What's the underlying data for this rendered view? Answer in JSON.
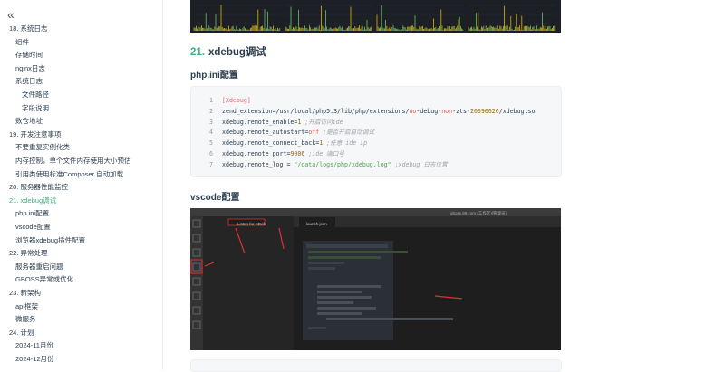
{
  "sidebar": {
    "collapse_icon": "double-chevron-left-icon",
    "items": [
      {
        "label": "18. 系统日志",
        "level": 1
      },
      {
        "label": "组件",
        "level": 2
      },
      {
        "label": "存储时间",
        "level": 2
      },
      {
        "label": "nginx日志",
        "level": 2
      },
      {
        "label": "系统日志",
        "level": 2
      },
      {
        "label": "文件路径",
        "level": 3
      },
      {
        "label": "字段说明",
        "level": 3
      },
      {
        "label": "数仓地址",
        "level": 2
      },
      {
        "label": "19. 开发注意事项",
        "level": 1
      },
      {
        "label": "不要重复实例化类",
        "level": 2
      },
      {
        "label": "内存控制，单个文件内存使用大小预估",
        "level": 2
      },
      {
        "label": "引用类使用标准Composer 自动加载",
        "level": 2
      },
      {
        "label": "20. 服务器性能监控",
        "level": 1
      },
      {
        "label": "21. xdebug调试",
        "level": 1,
        "active": true
      },
      {
        "label": "php.ini配置",
        "level": 2
      },
      {
        "label": "vscode配置",
        "level": 2
      },
      {
        "label": "浏览器xdebug插件配置",
        "level": 2
      },
      {
        "label": "22. 异常处理",
        "level": 1
      },
      {
        "label": "服务器重启问题",
        "level": 2
      },
      {
        "label": "GBOSS异常或优化",
        "level": 2
      },
      {
        "label": "23. 新架构",
        "level": 1
      },
      {
        "label": "api框架",
        "level": 2
      },
      {
        "label": "微服务",
        "level": 2
      },
      {
        "label": "24. 计划",
        "level": 1
      },
      {
        "label": "2024-11月份",
        "level": 2
      },
      {
        "label": "2024-12月份",
        "level": 2
      }
    ]
  },
  "main": {
    "section_number": "21.",
    "section_title": "xdebug调试",
    "phpini_heading": "php.ini配置",
    "vscode_heading": "vscode配置",
    "code_lines": [
      {
        "n": "1",
        "parts": [
          {
            "t": "[Xdebug]",
            "c": "sec"
          }
        ]
      },
      {
        "n": "2",
        "parts": [
          {
            "t": "zend_extension",
            "c": "key"
          },
          {
            "t": "=/usr/local/php5.3/lib/php/extensions/",
            "c": "key"
          },
          {
            "t": "no",
            "c": "val"
          },
          {
            "t": "-debug-",
            "c": "key"
          },
          {
            "t": "non",
            "c": "val"
          },
          {
            "t": "-zts-",
            "c": "key"
          },
          {
            "t": "20090626",
            "c": "num"
          },
          {
            "t": "/xdebug.so",
            "c": "key"
          }
        ]
      },
      {
        "n": "3",
        "parts": [
          {
            "t": "xdebug.remote_enable",
            "c": "key"
          },
          {
            "t": "=",
            "c": "key"
          },
          {
            "t": "1",
            "c": "num"
          },
          {
            "t": " ;开启访问ide",
            "c": "com"
          }
        ]
      },
      {
        "n": "4",
        "parts": [
          {
            "t": "xdebug.remote_autostart",
            "c": "key"
          },
          {
            "t": "=",
            "c": "key"
          },
          {
            "t": "off",
            "c": "val"
          },
          {
            "t": " ;是否开启自动调试",
            "c": "com"
          }
        ]
      },
      {
        "n": "5",
        "parts": [
          {
            "t": "xdebug.remote_connect_back",
            "c": "key"
          },
          {
            "t": "=",
            "c": "key"
          },
          {
            "t": "1",
            "c": "num"
          },
          {
            "t": " ;任意 ide ip",
            "c": "com"
          }
        ]
      },
      {
        "n": "6",
        "parts": [
          {
            "t": "xdebug.remote_port",
            "c": "key"
          },
          {
            "t": "=",
            "c": "key"
          },
          {
            "t": "9006",
            "c": "num"
          },
          {
            "t": " ;ide 端口号",
            "c": "com"
          }
        ]
      },
      {
        "n": "7",
        "parts": [
          {
            "t": "xdebug.remote_log",
            "c": "key"
          },
          {
            "t": " = ",
            "c": "key"
          },
          {
            "t": "\"/data/logs/php/xdebug.log\"",
            "c": "str"
          },
          {
            "t": " ;xdebug 日志位置",
            "c": "com"
          }
        ]
      }
    ]
  },
  "vscode_screenshot": {
    "tab_label": "launch.json",
    "debug_config": "Listen for XDeb",
    "window_title": "gboss.99.com (工作区)[管理员]"
  }
}
